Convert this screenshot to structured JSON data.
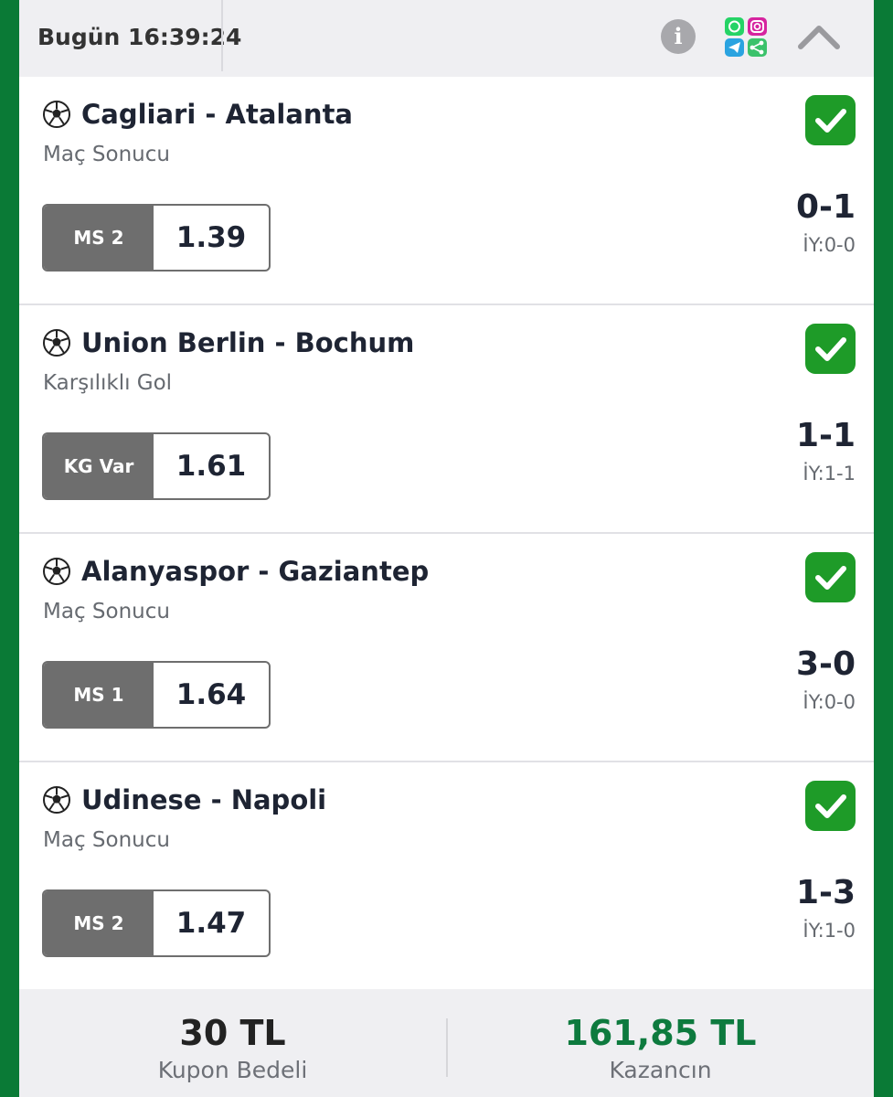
{
  "header": {
    "time": "Bugün 16:39:24"
  },
  "matches": [
    {
      "teams": "Cagliari - Atalanta",
      "market": "Maç Sonucu",
      "pick": "MS 2",
      "odd": "1.39",
      "score": "0-1",
      "half_time": "İY:0-0"
    },
    {
      "teams": "Union Berlin - Bochum",
      "market": "Karşılıklı Gol",
      "pick": "KG Var",
      "odd": "1.61",
      "score": "1-1",
      "half_time": "İY:1-1"
    },
    {
      "teams": "Alanyaspor - Gaziantep",
      "market": "Maç Sonucu",
      "pick": "MS 1",
      "odd": "1.64",
      "score": "3-0",
      "half_time": "İY:0-0"
    },
    {
      "teams": "Udinese - Napoli",
      "market": "Maç Sonucu",
      "pick": "MS 2",
      "odd": "1.47",
      "score": "1-3",
      "half_time": "İY:1-0"
    }
  ],
  "footer": {
    "stake_amount": "30 TL",
    "stake_label": "Kupon Bedeli",
    "win_amount": "161,85 TL",
    "win_label": "Kazancın"
  },
  "colors": {
    "frame": "#0a7a36",
    "win_check": "#1e9b28",
    "win_amount": "#0d7a3e",
    "pick_label_bg": "#6e6e6e"
  },
  "icons": [
    "info-icon",
    "share-social-icon",
    "chevron-up-icon",
    "soccer-ball-icon",
    "check-icon"
  ]
}
